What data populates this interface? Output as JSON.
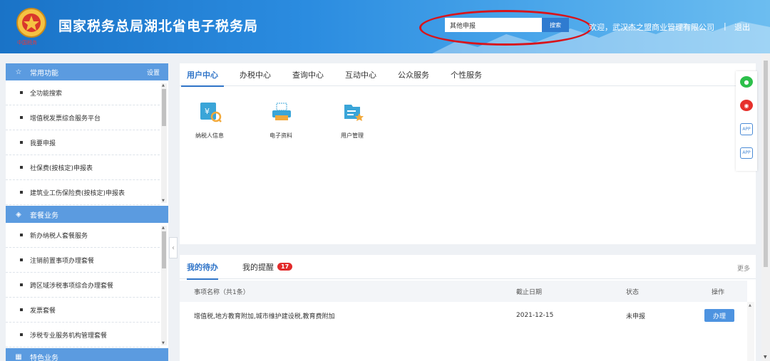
{
  "header": {
    "site_title": "国家税务总局湖北省电子税务局",
    "emblem_caption": "中国税务",
    "search": {
      "value": "其他申报",
      "button_label": "搜索"
    },
    "welcome": "欢迎，武汉杰之盟商业管理有限公司",
    "separator": "|",
    "logout_label": "退出"
  },
  "sidebar": {
    "sections": [
      {
        "title": "常用功能",
        "action_label": "设置",
        "icon": "star-icon",
        "items": [
          "全功能搜索",
          "增值税发票综合服务平台",
          "我要申报",
          "社保费(按核定)申报表",
          "建筑业工伤保险费(按核定)申报表"
        ]
      },
      {
        "title": "套餐业务",
        "icon": "layers-icon",
        "items": [
          "新办纳税人套餐服务",
          "注销前置事项办理套餐",
          "跨区域涉税事项综合办理套餐",
          "发票套餐",
          "涉税专业服务机构管理套餐"
        ]
      },
      {
        "title": "特色业务",
        "icon": "grid-icon"
      }
    ]
  },
  "main": {
    "tabs": [
      "用户中心",
      "办税中心",
      "查询中心",
      "互动中心",
      "公众服务",
      "个性服务"
    ],
    "active_tab": "用户中心",
    "tiles": [
      {
        "label": "纳税人信息",
        "icon": "taxpayer-info-icon"
      },
      {
        "label": "电子资料",
        "icon": "e-document-icon"
      },
      {
        "label": "用户管理",
        "icon": "user-management-icon"
      }
    ]
  },
  "todo": {
    "tabs": [
      {
        "label": "我的待办",
        "active": true
      },
      {
        "label": "我的提醒",
        "badge": "17"
      }
    ],
    "more_label": "更多",
    "columns": [
      "事项名称（共1条）",
      "截止日期",
      "状态",
      "操作"
    ],
    "rows": [
      {
        "name": "增值税,地方教育附加,城市维护建设税,教育费附加",
        "deadline": "2021-12-15",
        "status": "未申报",
        "action": "办理"
      }
    ]
  },
  "float_toolbar": {
    "icons": [
      "wechat-icon",
      "weibo-icon",
      "app-icon",
      "app-icon"
    ],
    "app_label": "APP"
  },
  "colors": {
    "header_blue": "#2b8ce0",
    "section_blue": "#5b9be0",
    "accent": "#2f74c8",
    "badge_red": "#e22b2b",
    "annotation_red": "#d8141b"
  }
}
